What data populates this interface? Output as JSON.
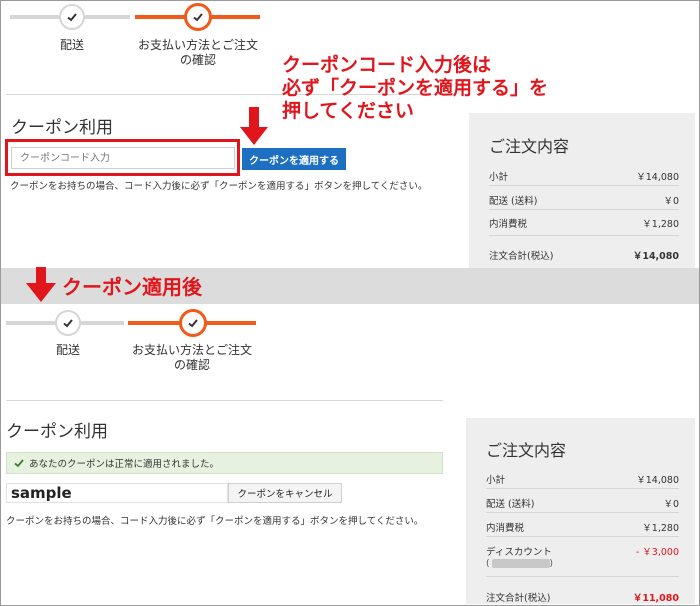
{
  "callout": {
    "line1": "クーポンコード入力後は",
    "line2": "必ず「クーポンを適用する」を",
    "line3": "押してください"
  },
  "band_text": "クーポン適用後",
  "before": {
    "steps": [
      {
        "label": "配送"
      },
      {
        "label_line1": "お支払い方法とご注文",
        "label_line2": "の確認"
      }
    ],
    "coupon_title": "クーポン利用",
    "coupon_placeholder": "クーポンコード入力",
    "apply_button": "クーポンを適用する",
    "note": "クーポンをお持ちの場合、コード入力後に必ず「クーポンを適用する」ボタンを押してください。",
    "summary": {
      "title": "ご注文内容",
      "rows": [
        {
          "label": "小計",
          "value": "￥14,080"
        },
        {
          "label": "配送 (送料)",
          "value": "￥0"
        },
        {
          "label": "内消費税",
          "value": "￥1,280"
        }
      ],
      "total_label": "注文合計(税込)",
      "total_value": "￥14,080"
    }
  },
  "after": {
    "steps": [
      {
        "label": "配送"
      },
      {
        "label_line1": "お支払い方法とご注文",
        "label_line2": "の確認"
      }
    ],
    "coupon_title": "クーポン利用",
    "success_message": "あなたのクーポンは正常に適用されました。",
    "coupon_value": "sample",
    "cancel_button": "クーポンをキャンセル",
    "note": "クーポンをお持ちの場合、コード入力後に必ず「クーポンを適用する」ボタンを押してください。",
    "summary": {
      "title": "ご注文内容",
      "rows": [
        {
          "label": "小計",
          "value": "￥14,080"
        },
        {
          "label": "配送 (送料)",
          "value": "￥0"
        },
        {
          "label": "内消費税",
          "value": "￥1,280"
        }
      ],
      "discount_label": "ディスカウント",
      "discount_value": "- ￥3,000",
      "total_label": "注文合計(税込)",
      "total_value": "￥11,080"
    }
  },
  "colors": {
    "accent_orange": "#f05a1a",
    "callout_red": "#e0161c",
    "button_blue": "#1d6fc2",
    "success_bg": "#e6f1df"
  }
}
